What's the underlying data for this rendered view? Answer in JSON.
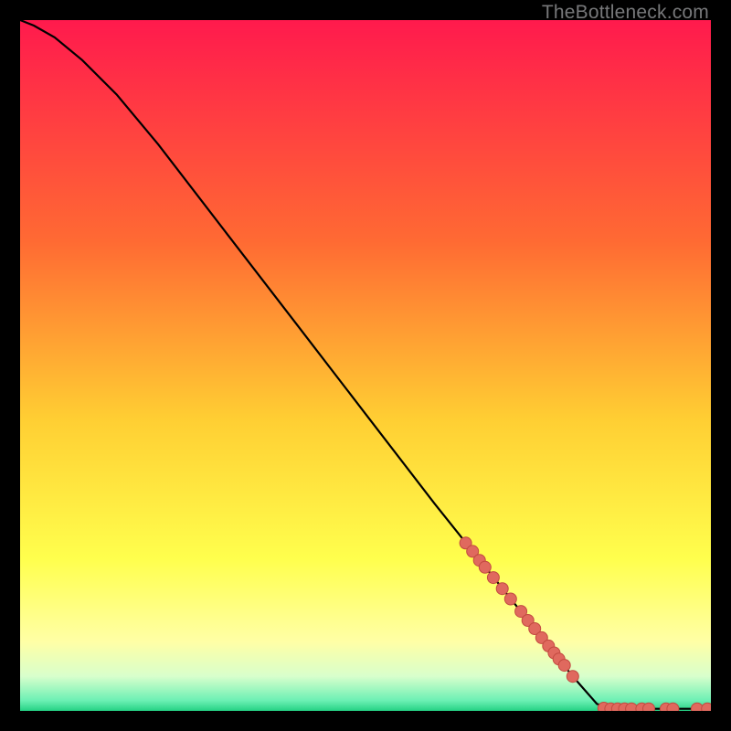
{
  "attribution": "TheBottleneck.com",
  "colors": {
    "background": "#000000",
    "gradient_top": "#ff1a4d",
    "gradient_mid1": "#ff8a33",
    "gradient_mid2": "#ffe433",
    "gradient_low1": "#ffff66",
    "gradient_low2": "#f0ffb0",
    "gradient_green": "#2ee59d",
    "curve_stroke": "#000000",
    "marker_fill": "#e0695e",
    "marker_stroke": "#c24a40"
  },
  "chart_data": {
    "type": "line",
    "title": "",
    "xlabel": "",
    "ylabel": "",
    "xlim": [
      0,
      100
    ],
    "ylim": [
      0,
      100
    ],
    "curve": [
      {
        "x": 0,
        "y": 100
      },
      {
        "x": 2,
        "y": 99.2
      },
      {
        "x": 5,
        "y": 97.5
      },
      {
        "x": 9,
        "y": 94.2
      },
      {
        "x": 14,
        "y": 89.2
      },
      {
        "x": 20,
        "y": 82.0
      },
      {
        "x": 30,
        "y": 69.0
      },
      {
        "x": 40,
        "y": 56.0
      },
      {
        "x": 50,
        "y": 43.0
      },
      {
        "x": 60,
        "y": 30.0
      },
      {
        "x": 70,
        "y": 17.5
      },
      {
        "x": 80,
        "y": 5.0
      },
      {
        "x": 83.5,
        "y": 1.0
      },
      {
        "x": 86,
        "y": 0.3
      },
      {
        "x": 100,
        "y": 0.3
      }
    ],
    "markers": [
      {
        "x": 64.5,
        "y": 24.3
      },
      {
        "x": 65.5,
        "y": 23.1
      },
      {
        "x": 66.5,
        "y": 21.8
      },
      {
        "x": 67.3,
        "y": 20.8
      },
      {
        "x": 68.5,
        "y": 19.3
      },
      {
        "x": 69.8,
        "y": 17.7
      },
      {
        "x": 71.0,
        "y": 16.2
      },
      {
        "x": 72.5,
        "y": 14.4
      },
      {
        "x": 73.5,
        "y": 13.1
      },
      {
        "x": 74.5,
        "y": 11.9
      },
      {
        "x": 75.5,
        "y": 10.6
      },
      {
        "x": 76.5,
        "y": 9.4
      },
      {
        "x": 77.3,
        "y": 8.4
      },
      {
        "x": 78.0,
        "y": 7.5
      },
      {
        "x": 78.8,
        "y": 6.6
      },
      {
        "x": 80.0,
        "y": 5.0
      },
      {
        "x": 84.5,
        "y": 0.4
      },
      {
        "x": 85.5,
        "y": 0.3
      },
      {
        "x": 86.5,
        "y": 0.3
      },
      {
        "x": 87.5,
        "y": 0.3
      },
      {
        "x": 88.5,
        "y": 0.3
      },
      {
        "x": 90.0,
        "y": 0.3
      },
      {
        "x": 91.0,
        "y": 0.3
      },
      {
        "x": 93.5,
        "y": 0.3
      },
      {
        "x": 94.5,
        "y": 0.3
      },
      {
        "x": 98.0,
        "y": 0.3
      },
      {
        "x": 99.5,
        "y": 0.3
      }
    ]
  }
}
